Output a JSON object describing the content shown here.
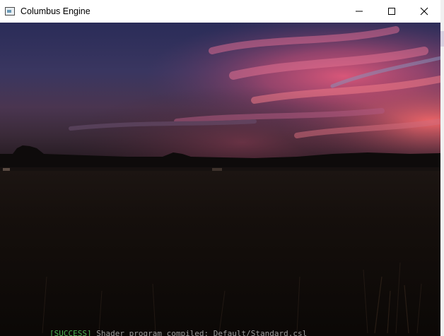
{
  "window": {
    "title": "Columbus Engine",
    "controls": {
      "minimize": "minimize",
      "maximize": "maximize",
      "close": "close"
    }
  },
  "scene": {
    "description_icon": "sunset-field-render"
  },
  "console": {
    "status": "[SUCCESS]",
    "message": "Shader program compiled: Default/Standard.csl"
  },
  "colors": {
    "titlebar": "#ffffff",
    "sky_top": "#2b2f5a",
    "sky_glow": "#d0506e",
    "ground": "#120d0a"
  }
}
